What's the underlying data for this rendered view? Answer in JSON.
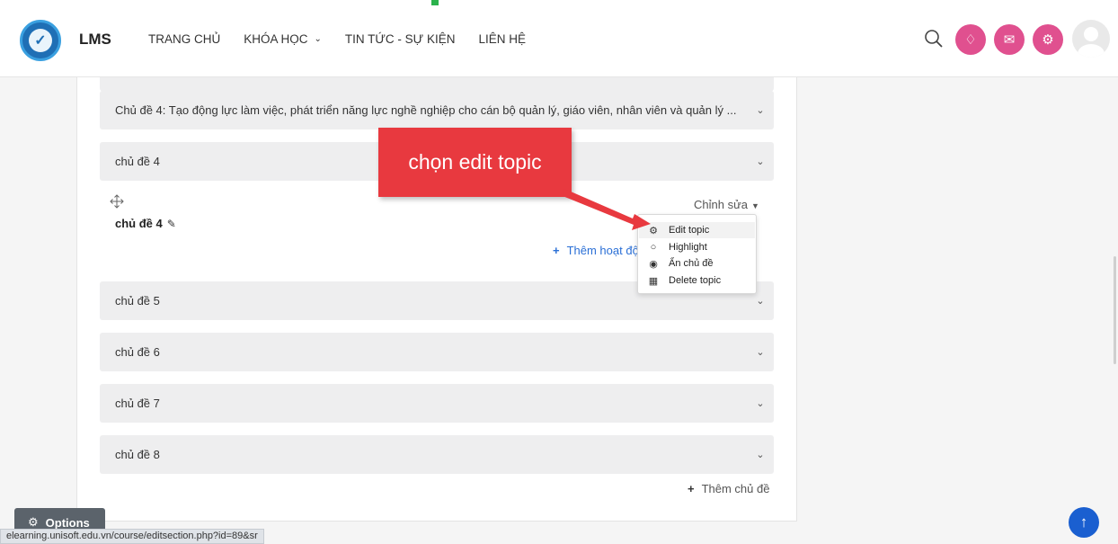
{
  "header": {
    "brand": "LMS",
    "nav": [
      {
        "label": "TRANG CHỦ"
      },
      {
        "label": "KHÓA HỌC",
        "has_dropdown": true
      },
      {
        "label": "TIN TỨC - SỰ KIỆN"
      },
      {
        "label": "LIÊN HỆ"
      }
    ],
    "icons": [
      "search-icon",
      "bell-icon",
      "chat-icon",
      "gear-icon",
      "avatar"
    ],
    "accent_color": "#e0508f"
  },
  "sections": [
    {
      "title": "Chủ đề 4: Tạo động lực làm việc, phát triển năng lực nghề nghiệp cho cán bộ quản lý, giáo viên, nhân viên và quản lý ..."
    },
    {
      "title": "chủ đề 4"
    },
    {
      "title": "chủ đề 5"
    },
    {
      "title": "chủ đề 6"
    },
    {
      "title": "chủ đề 7"
    },
    {
      "title": "chủ đề 8"
    }
  ],
  "expanded_topic": {
    "name": "chủ đề 4",
    "edit_label": "Chỉnh sửa",
    "add_activity": "Thêm hoạt động"
  },
  "edit_menu": {
    "items": [
      {
        "label": "Edit topic",
        "icon": "gear-icon"
      },
      {
        "label": "Highlight",
        "icon": "circle-icon"
      },
      {
        "label": "Ẩn chủ đề",
        "icon": "eye-icon"
      },
      {
        "label": "Delete topic",
        "icon": "trash-icon"
      }
    ]
  },
  "add_topic": "Thêm chủ đề",
  "annotation": {
    "text": "chọn edit topic",
    "color": "#e8393f"
  },
  "options_button": "Options",
  "status_url": "elearning.unisoft.edu.vn/course/editsection.php?id=89&sr",
  "back_to_top_color": "#1a5fd0"
}
